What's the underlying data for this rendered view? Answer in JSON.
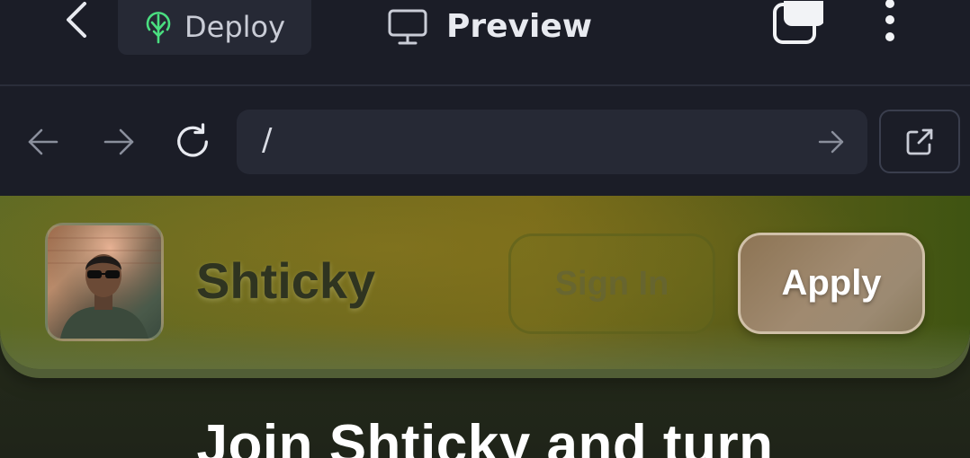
{
  "topbar": {
    "back_icon": "chevron-left-icon",
    "deploy_label": "Deploy",
    "deploy_icon": "deploy-tree-icon",
    "deploy_icon_color": "#4ade80",
    "preview_label": "Preview",
    "preview_icon": "monitor-icon",
    "copy_icon": "copy-icon",
    "more_icon": "more-vertical-icon"
  },
  "browser": {
    "back_icon": "arrow-left-icon",
    "forward_icon": "arrow-right-icon",
    "reload_icon": "reload-icon",
    "url": "/",
    "go_icon": "arrow-right-icon",
    "open_external_icon": "external-link-icon"
  },
  "site": {
    "brand": "Shticky",
    "signin_label": "Sign In",
    "apply_label": "Apply",
    "hero_title": "Join Shticky and turn",
    "accent_color": "#9c8a72"
  }
}
